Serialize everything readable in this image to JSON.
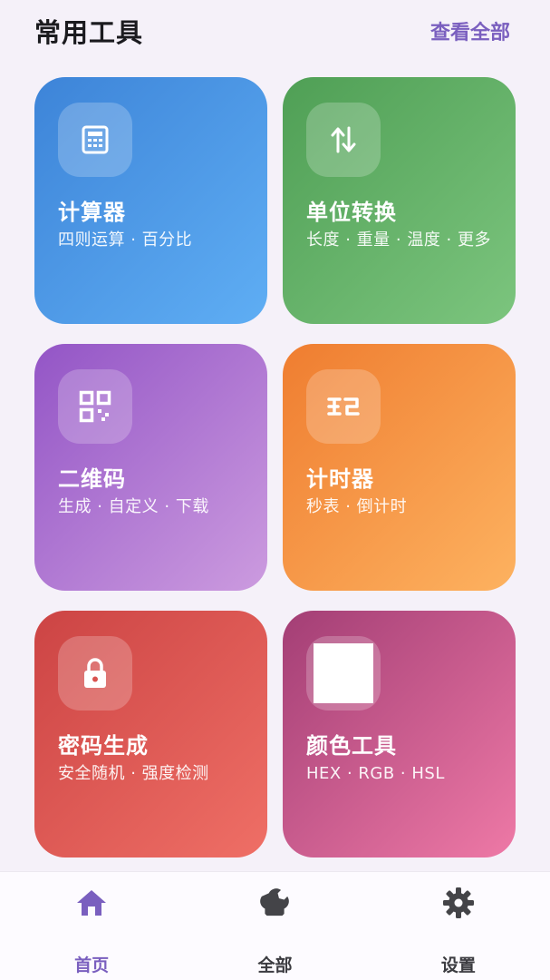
{
  "header": {
    "title": "常用工具",
    "view_all": "查看全部"
  },
  "tools": [
    {
      "title": "计算器",
      "subtitle": "四则运算 · 百分比",
      "icon": "calculator-icon",
      "color": "#3d84d8"
    },
    {
      "title": "单位转换",
      "subtitle": "长度 · 重量 · 温度 · 更多",
      "icon": "swap-vertical-icon",
      "color": "#4f9f55"
    },
    {
      "title": "二维码",
      "subtitle": "生成 · 自定义 · 下载",
      "icon": "qr-code-icon",
      "color": "#9355c6"
    },
    {
      "title": "计时器",
      "subtitle": "秒表 · 倒计时",
      "icon": "timer-icon",
      "color": "#ef7d30"
    },
    {
      "title": "密码生成",
      "subtitle": "安全随机 · 强度检测",
      "icon": "lock-icon",
      "color": "#cc4444"
    },
    {
      "title": "颜色工具",
      "subtitle": "HEX · RGB · HSL",
      "icon": "color-swatch-icon",
      "color": "#a33e75"
    }
  ],
  "nav": {
    "home": {
      "label": "首页",
      "icon": "home-icon",
      "active": true
    },
    "all": {
      "label": "全部",
      "icon": "wrench-icon",
      "active": false
    },
    "settings": {
      "label": "设置",
      "icon": "gear-icon",
      "active": false
    }
  },
  "colors": {
    "accent": "#7a5fbf",
    "background": "#f5f1f9"
  }
}
